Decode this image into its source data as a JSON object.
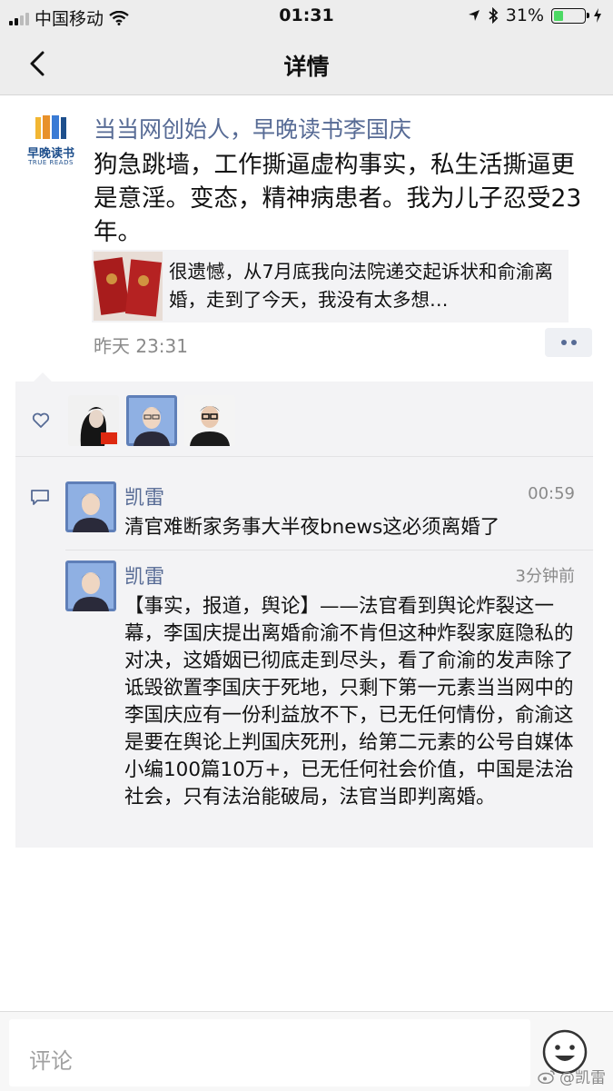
{
  "status_bar": {
    "carrier": "中国移动",
    "time": "01:31",
    "battery_text": "31%",
    "battery_level": 0.31
  },
  "nav": {
    "title": "详情"
  },
  "post": {
    "logo_brand": "早晚读书",
    "logo_sub": "TRUE READS",
    "author": "当当网创始人，早晚读书李国庆",
    "text": "狗急跳墙，工作撕逼虚构事实，私生活撕逼更是意淫。变态，精神病患者。我为儿子忍受23年。",
    "link_card": {
      "text": "很遗憾，从7月底我向法院递交起诉状和俞渝离婚，走到了今天，我没有太多想…"
    },
    "timestamp": "昨天 23:31"
  },
  "interactions": {
    "comments": [
      {
        "name": "凯雷",
        "time": "00:59",
        "text": "清官难断家务事大半夜bnews这必须离婚了"
      },
      {
        "name": "凯雷",
        "time": "3分钟前",
        "text": "【事实，报道，舆论】——法官看到舆论炸裂这一幕，李国庆提出离婚俞渝不肯但这种炸裂家庭隐私的对决，这婚姻已彻底走到尽头，看了俞渝的发声除了诋毁欲置李国庆于死地，只剩下第一元素当当网中的李国庆应有一份利益放不下，已无任何情份，俞渝这是要在舆论上判国庆死刑，给第二元素的公号自媒体小编100篇10万+，已无任何社会价值，中国是法治社会，只有法治能破局，法官当即判离婚。"
      }
    ]
  },
  "bottom_bar": {
    "placeholder": "评论",
    "watermark": "@凯雷"
  },
  "colors": {
    "link_blue": "#576b95",
    "background_gray": "#ededed",
    "panel_gray": "#f3f3f5"
  }
}
